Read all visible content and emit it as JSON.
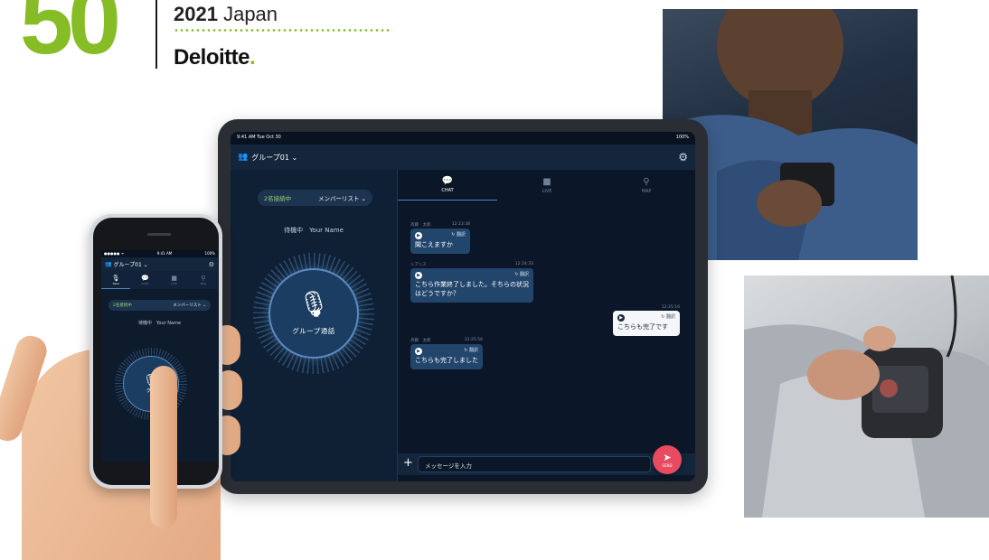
{
  "badge": {
    "number": "50",
    "year": "2021",
    "country": "Japan",
    "logo": "Deloitte",
    "logo_dot": "."
  },
  "tablet": {
    "status_time": "9:41 AM  Tue Oct 30",
    "status_battery": "100%",
    "group_name": "グループ01 ⌄",
    "connection_count": "2名接続中",
    "member_list": "メンバーリスト ⌄",
    "standby_label": "待機中",
    "user_name": "Your Name",
    "talk_button_label": "グループ通話",
    "tabs": [
      {
        "label": "CHAT",
        "icon": "💬"
      },
      {
        "label": "LIVE",
        "icon": "■"
      },
      {
        "label": "MAP",
        "icon": "⚲"
      }
    ],
    "translate_label": "↻ 翻訳",
    "messages": [
      {
        "sender": "斉藤　太郎",
        "time": "12:23:38",
        "text": "聞こえますか"
      },
      {
        "sender": "シアンス",
        "time": "12:24:33",
        "text": "こちら作業終了しました。そちらの状況はどうですか？"
      },
      {
        "sender": "",
        "time": "12:25:16",
        "text": "こちらも完了です"
      },
      {
        "sender": "斉藤　太郎",
        "time": "12:25:56",
        "text": "こちらも完了しました"
      }
    ],
    "input_placeholder": "メッセージを入力",
    "send_label": "SEND"
  },
  "phone": {
    "status_carrier": "●●●●● ᯤ",
    "status_time": "9:41 AM",
    "status_battery": "100%",
    "group_name": "グループ01 ⌄",
    "tabs": [
      "TALK",
      "CHAT",
      "LIVE",
      "MAP"
    ],
    "connection_count": "2名接続中",
    "member_list": "メンバーリスト ⌄",
    "standby_label": "待機中",
    "user_name": "Your Name",
    "talk_button_label": "グル"
  }
}
